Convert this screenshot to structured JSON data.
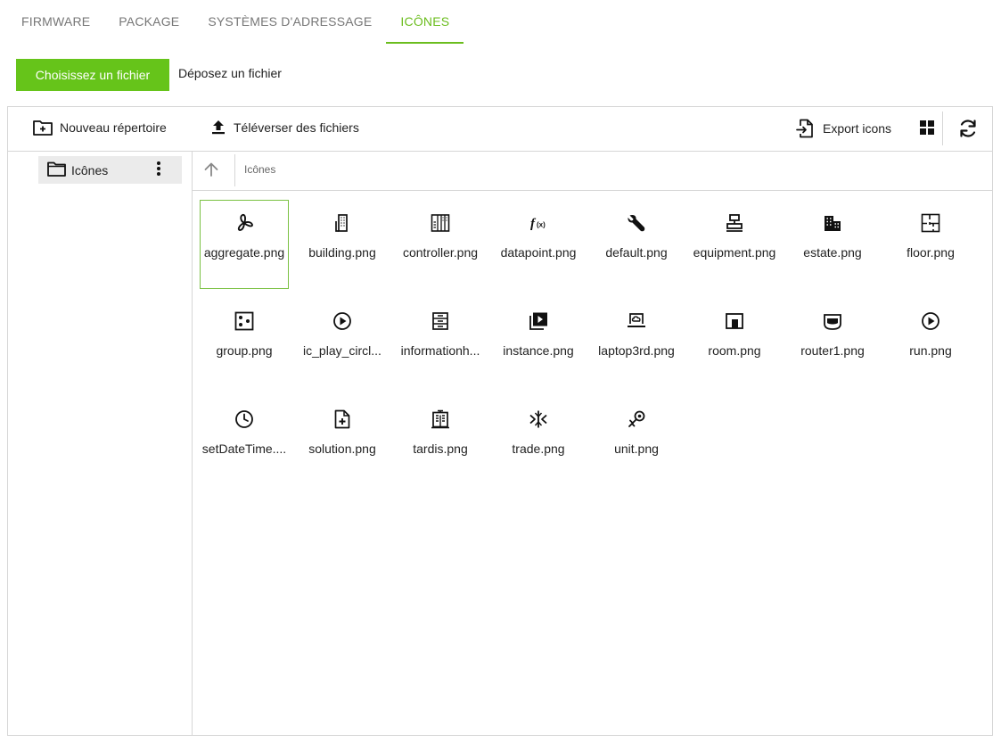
{
  "tabs": [
    {
      "label": "FIRMWARE"
    },
    {
      "label": "PACKAGE"
    },
    {
      "label": "SYSTÈMES D'ADRESSAGE"
    },
    {
      "label": "ICÔNES",
      "active": true
    }
  ],
  "upload": {
    "choose_label": "Choisissez un fichier",
    "drop_label": "Déposez un fichier"
  },
  "toolbar": {
    "new_folder_label": "Nouveau répertoire",
    "upload_label": "Téléverser des fichiers",
    "export_label": "Export icons",
    "icons": [
      "folder-plus-icon",
      "upload-icon",
      "export-file-icon",
      "grid-view-icon",
      "refresh-icon"
    ]
  },
  "sidebar": {
    "items": [
      {
        "label": "Icônes",
        "icon": "folder-icon",
        "menu_icon": "more-vertical-icon"
      }
    ]
  },
  "breadcrumb": {
    "up_icon": "arrow-up-icon",
    "path": "Icônes"
  },
  "files": [
    {
      "name": "aggregate.png",
      "icon": "fan-icon"
    },
    {
      "name": "building.png",
      "icon": "building-icon"
    },
    {
      "name": "controller.png",
      "icon": "controller-icon"
    },
    {
      "name": "datapoint.png",
      "icon": "function-icon"
    },
    {
      "name": "default.png",
      "icon": "wrench-icon"
    },
    {
      "name": "equipment.png",
      "icon": "equipment-icon"
    },
    {
      "name": "estate.png",
      "icon": "estate-icon"
    },
    {
      "name": "floor.png",
      "icon": "floor-plan-icon"
    },
    {
      "name": "group.png",
      "icon": "dice-icon"
    },
    {
      "name": "ic_play_circl...",
      "icon": "play-circle-icon"
    },
    {
      "name": "informationh...",
      "icon": "server-icon"
    },
    {
      "name": "instance.png",
      "icon": "video-library-icon"
    },
    {
      "name": "laptop3rd.png",
      "icon": "laptop-cloud-icon"
    },
    {
      "name": "room.png",
      "icon": "room-icon"
    },
    {
      "name": "router1.png",
      "icon": "router-icon"
    },
    {
      "name": "run.png",
      "icon": "play-circle-icon"
    },
    {
      "name": "setDateTime....",
      "icon": "clock-icon"
    },
    {
      "name": "solution.png",
      "icon": "file-plus-icon"
    },
    {
      "name": "tardis.png",
      "icon": "tardis-icon"
    },
    {
      "name": "trade.png",
      "icon": "trade-icon"
    },
    {
      "name": "unit.png",
      "icon": "unit-icon"
    }
  ],
  "selected_file": "aggregate.png",
  "colors": {
    "accent": "#66c41a",
    "selection_border": "#7ac142",
    "border": "#d6d6d6",
    "tree_selected_bg": "#ebebeb"
  }
}
